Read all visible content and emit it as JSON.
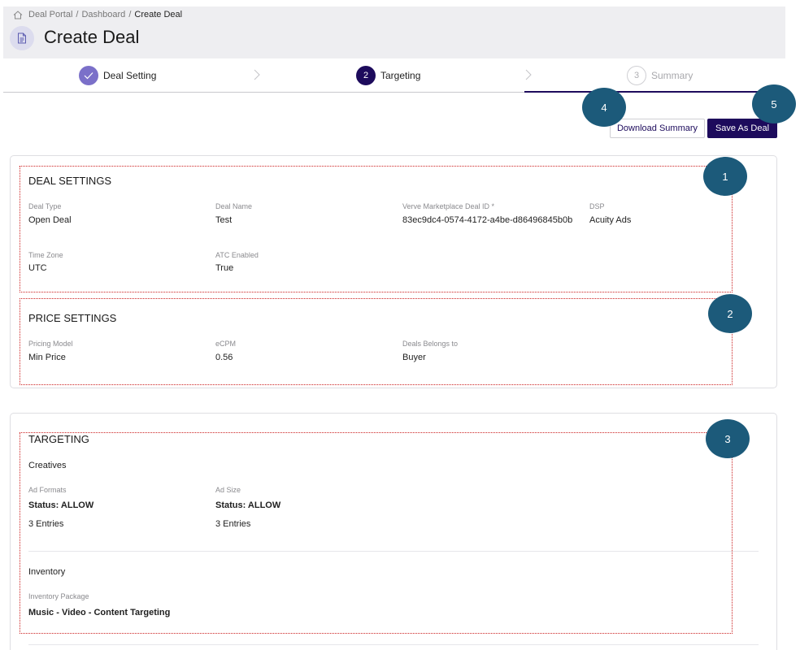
{
  "breadcrumb": {
    "items": [
      "Deal Portal",
      "Dashboard",
      "Create Deal"
    ]
  },
  "page": {
    "title": "Create Deal",
    "icon": "document-icon"
  },
  "stepper": {
    "steps": [
      {
        "label": "Deal Setting",
        "number": "",
        "state": "completed"
      },
      {
        "label": "Targeting",
        "number": "2",
        "state": "active"
      },
      {
        "label": "Summary",
        "number": "3",
        "state": "pending"
      }
    ]
  },
  "actions": {
    "download_label": "Download Summary",
    "save_label": "Save As Deal"
  },
  "markers": [
    "1",
    "2",
    "3",
    "4",
    "5"
  ],
  "deal_settings": {
    "title": "DEAL SETTINGS",
    "fields": [
      {
        "label": "Deal Type",
        "value": "Open Deal"
      },
      {
        "label": "Deal Name",
        "value": "Test"
      },
      {
        "label": "Verve Marketplace Deal ID *",
        "value": "83ec9dc4-0574-4172-a4be-d86496845b0b"
      },
      {
        "label": "DSP",
        "value": "Acuity Ads"
      },
      {
        "label": "Time Zone",
        "value": "UTC"
      },
      {
        "label": "ATC Enabled",
        "value": "True"
      }
    ]
  },
  "price_settings": {
    "title": "PRICE SETTINGS",
    "fields": [
      {
        "label": "Pricing Model",
        "value": "Min Price"
      },
      {
        "label": "eCPM",
        "value": "0.56"
      },
      {
        "label": "Deals Belongs to",
        "value": "Buyer"
      }
    ]
  },
  "targeting": {
    "title": "TARGETING",
    "creatives": {
      "title": "Creatives",
      "fields": [
        {
          "label": "Ad Formats",
          "status": "Status: ALLOW",
          "entries": "3 Entries"
        },
        {
          "label": "Ad Size",
          "status": "Status: ALLOW",
          "entries": "3 Entries"
        }
      ]
    },
    "inventory": {
      "title": "Inventory",
      "package_label": "Inventory Package",
      "package_value": "Music - Video - Content Targeting"
    }
  },
  "colors": {
    "primary": "#1d0b5c",
    "completed_step": "#7b70c9",
    "marker": "#1c5a7a",
    "highlight_border": "#cc2222",
    "header_bg": "#eeeef1"
  }
}
